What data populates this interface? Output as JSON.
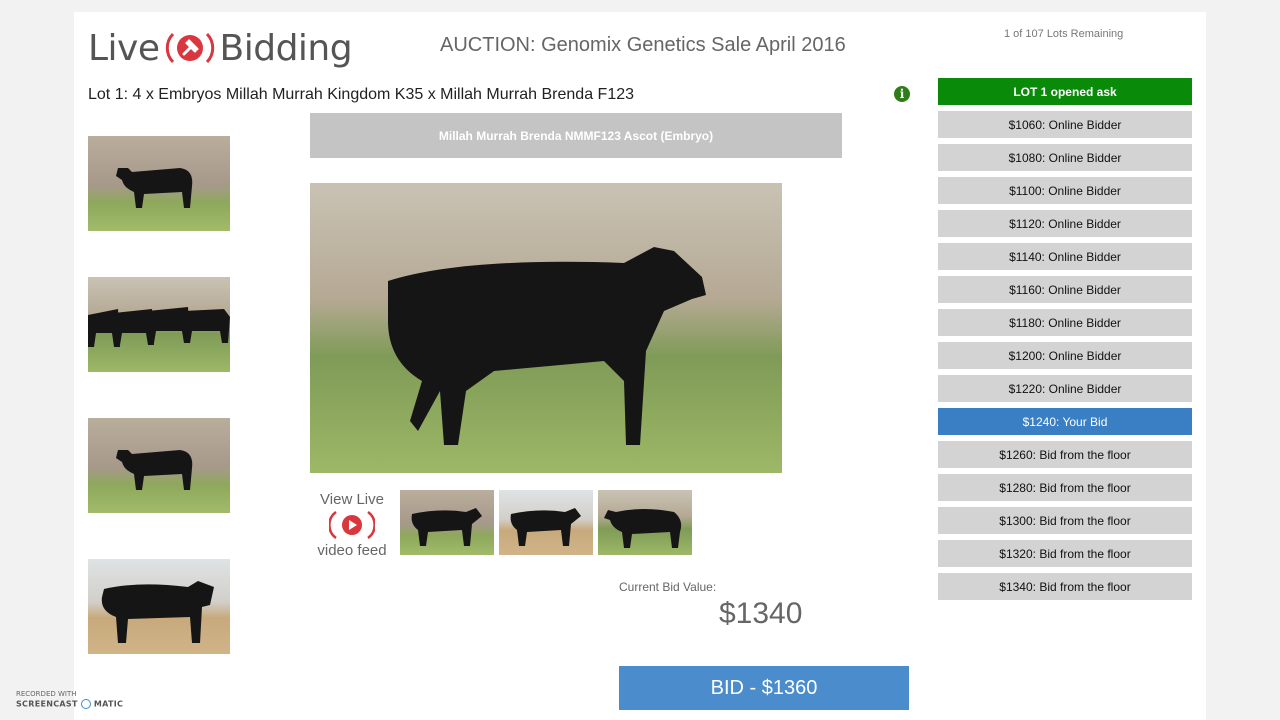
{
  "brand": {
    "word_left": "Live",
    "word_right": "Bidding",
    "accent": "#d9363e"
  },
  "auction": {
    "title": "AUCTION: Genomix Genetics Sale April 2016",
    "lots_remaining": "1 of 107 Lots Remaining"
  },
  "lot": {
    "title": "Lot 1: 4 x Embryos Millah Murrah Kingdom K35 x Millah Murrah Brenda F123",
    "photo_caption": "Millah Murrah Brenda NMMF123 Ascot (Embryo)",
    "info_icon": "info-icon"
  },
  "live_feed": {
    "line1": "View Live",
    "line2": "video feed"
  },
  "bidding": {
    "current_label": "Current Bid Value:",
    "current_value": "$1340",
    "bid_button": "BID - $1360"
  },
  "bid_history": [
    {
      "text": "LOT 1 opened ask",
      "status": "opened"
    },
    {
      "text": "$1060: Online Bidder",
      "status": "normal"
    },
    {
      "text": "$1080: Online Bidder",
      "status": "normal"
    },
    {
      "text": "$1100: Online Bidder",
      "status": "normal"
    },
    {
      "text": "$1120: Online Bidder",
      "status": "normal"
    },
    {
      "text": "$1140: Online Bidder",
      "status": "normal"
    },
    {
      "text": "$1160: Online Bidder",
      "status": "normal"
    },
    {
      "text": "$1180: Online Bidder",
      "status": "normal"
    },
    {
      "text": "$1200: Online Bidder",
      "status": "normal"
    },
    {
      "text": "$1220: Online Bidder",
      "status": "normal"
    },
    {
      "text": "$1240: Your Bid",
      "status": "yours"
    },
    {
      "text": "$1260: Bid from the floor",
      "status": "normal"
    },
    {
      "text": "$1280: Bid from the floor",
      "status": "normal"
    },
    {
      "text": "$1300: Bid from the floor",
      "status": "normal"
    },
    {
      "text": "$1320: Bid from the floor",
      "status": "normal"
    },
    {
      "text": "$1340: Bid from the floor",
      "status": "normal"
    }
  ],
  "watermark": {
    "line1": "RECORDED WITH",
    "line2": "SCREENCAST",
    "line3": "MATIC"
  },
  "colors": {
    "opened": "#098b09",
    "your_bid": "#3a7fc3",
    "bid_button": "#4a8ccc",
    "row": "#d3d3d3"
  }
}
